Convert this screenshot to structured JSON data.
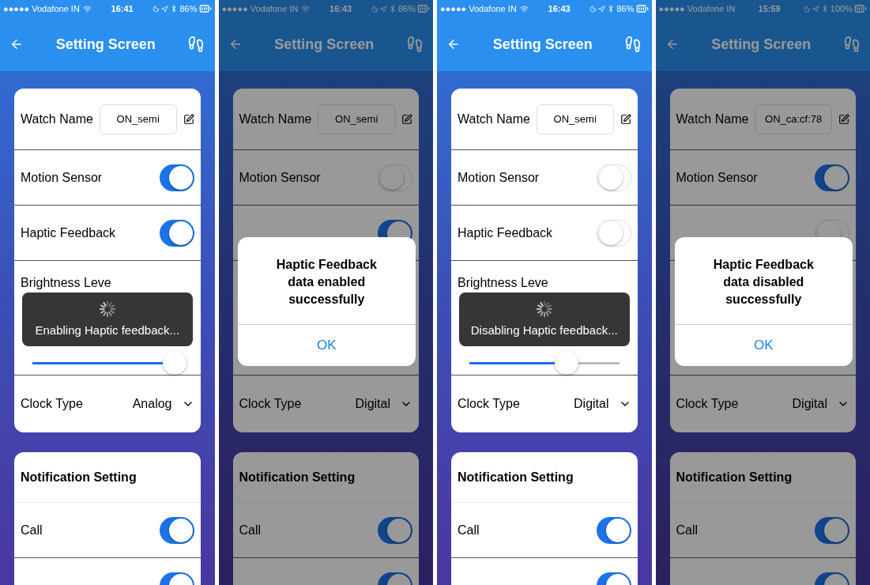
{
  "phones": [
    {
      "status": {
        "carrier": "●●●●● Vodafone IN",
        "wifi": true,
        "time": "16:41",
        "battery": "86%"
      },
      "title": "Setting Screen",
      "watch_name": {
        "label": "Watch Name",
        "value": "ON_semi"
      },
      "toggles": [
        {
          "label": "Motion Sensor",
          "on": true
        },
        {
          "label": "Haptic Feedback",
          "on": true
        }
      ],
      "brightness": {
        "label": "Brightness Leve",
        "level": 0.95
      },
      "clock": {
        "label": "Clock Type",
        "value": "Analog"
      },
      "notification": {
        "title": "Notification Setting",
        "items": [
          {
            "label": "Call",
            "on": true
          },
          {
            "on": true
          }
        ]
      },
      "overlay": {
        "kind": "loading",
        "text": "Enabling Haptic feedback..."
      }
    },
    {
      "status": {
        "carrier": "●●●●● Vodafone IN",
        "wifi": true,
        "time": "16:43",
        "battery": "86%"
      },
      "title": "Setting Screen",
      "watch_name": {
        "label": "Watch Name",
        "value": "ON_semi"
      },
      "toggles": [
        {
          "label": "Motion Sensor",
          "on": false
        },
        {
          "on": true
        }
      ],
      "clock": {
        "label": "Clock Type",
        "value": "Digital"
      },
      "notification": {
        "title": "Notification Setting",
        "items": [
          {
            "label": "Call",
            "on": true
          },
          {
            "on": true
          }
        ]
      },
      "overlay": {
        "kind": "alert",
        "text": "Haptic Feedback data enabled successfully",
        "button": "OK"
      }
    },
    {
      "status": {
        "carrier": "●●●●● Vodafone IN",
        "wifi": true,
        "time": "16:43",
        "battery": "86%"
      },
      "title": "Setting Screen",
      "watch_name": {
        "label": "Watch Name",
        "value": "ON_semi"
      },
      "toggles": [
        {
          "label": "Motion Sensor",
          "on": false
        },
        {
          "label": "Haptic Feedback",
          "on": false
        }
      ],
      "brightness": {
        "label": "Brightness Leve",
        "level": 0.65
      },
      "clock": {
        "label": "Clock Type",
        "value": "Digital"
      },
      "notification": {
        "title": "Notification Setting",
        "items": [
          {
            "label": "Call",
            "on": true
          },
          {
            "on": true
          }
        ]
      },
      "overlay": {
        "kind": "loading",
        "text": "Disabling Haptic feedback..."
      }
    },
    {
      "status": {
        "carrier": "●●●●● Vodafone IN",
        "wifi": false,
        "time": "15:59",
        "battery": "100%"
      },
      "title": "Setting Screen",
      "watch_name": {
        "label": "Watch Name",
        "value": "ON_ca:cf:78"
      },
      "toggles": [
        {
          "label": "Motion Sensor",
          "on": true
        },
        {
          "on": false
        }
      ],
      "clock": {
        "label": "Clock Type",
        "value": "Digital"
      },
      "notification": {
        "title": "Notification Setting",
        "items": [
          {
            "label": "Call",
            "on": true
          },
          {
            "on": true
          }
        ]
      },
      "overlay": {
        "kind": "alert",
        "text": "Haptic Feedback data disabled successfully",
        "button": "OK"
      }
    }
  ]
}
